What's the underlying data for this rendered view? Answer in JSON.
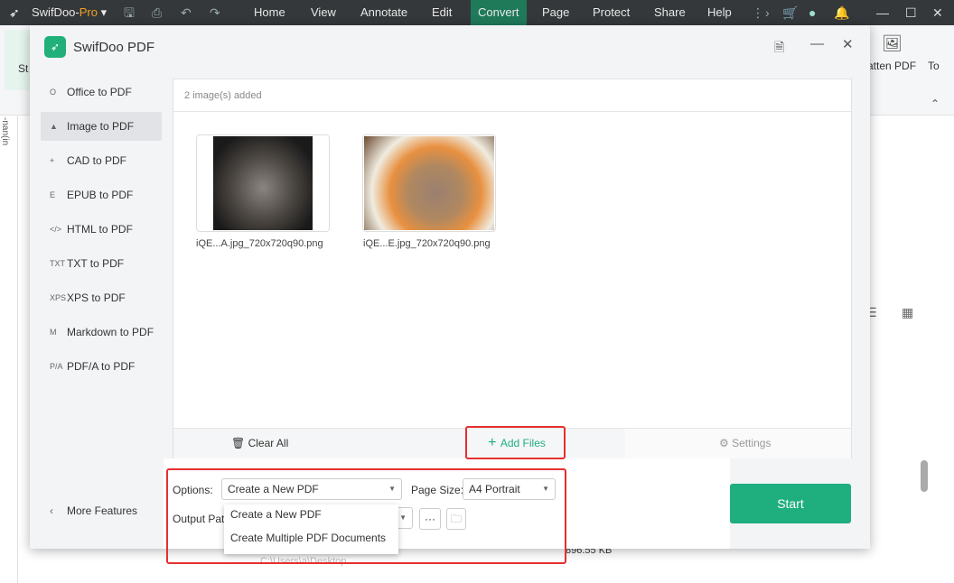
{
  "app": {
    "brand": "SwifDoo-",
    "brand_pro": "Pro",
    "menus": [
      "Home",
      "View",
      "Annotate",
      "Edit",
      "Convert",
      "Page",
      "Protect",
      "Share",
      "Help"
    ],
    "active_menu": "Convert",
    "accent": "#1f7a5a"
  },
  "background": {
    "ribbon_left": "St",
    "ribbon_right": "atten PDF",
    "ribbon_right2": "To",
    "side_text": "-nan(in",
    "file_size": "896.55 KB",
    "file_path": "C:\\Users\\a\\Desktop"
  },
  "dialog": {
    "title": "SwifDoo PDF",
    "sidebar": [
      {
        "label": "Office to PDF",
        "icon": "O"
      },
      {
        "label": "Image to PDF",
        "icon": "▲"
      },
      {
        "label": "CAD to PDF",
        "icon": "+"
      },
      {
        "label": "EPUB to PDF",
        "icon": "E"
      },
      {
        "label": "HTML to PDF",
        "icon": "</>"
      },
      {
        "label": "TXT to PDF",
        "icon": "TXT"
      },
      {
        "label": "XPS to PDF",
        "icon": "XPS"
      },
      {
        "label": "Markdown to PDF",
        "icon": "M"
      },
      {
        "label": "PDF/A to PDF",
        "icon": "P/A"
      }
    ],
    "selected": "Image to PDF",
    "more_features": "More Features",
    "count_text": "2 image(s) added",
    "files": [
      {
        "name": "iQE...A.jpg_720x720q90.png"
      },
      {
        "name": "iQE...E.jpg_720x720q90.png"
      }
    ],
    "clear_all": "Clear All",
    "add_files": "Add Files",
    "settings": "Settings",
    "options_label": "Options:",
    "options_value": "Create a New PDF",
    "page_size_label": "Page Size:",
    "page_size_value": "A4 Portrait",
    "output_label": "Output Path:",
    "dropdown": [
      "Create a New PDF",
      "Create Multiple PDF Documents"
    ],
    "more_btn": "···",
    "start": "Start",
    "start_color": "#1fae7e"
  }
}
